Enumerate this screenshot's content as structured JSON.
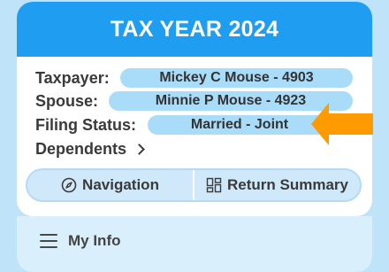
{
  "header": {
    "title": "TAX YEAR 2024"
  },
  "info": {
    "taxpayer_label": "Taxpayer:",
    "taxpayer_value": "Mickey C Mouse - 4903",
    "spouse_label": "Spouse:",
    "spouse_value": "Minnie P Mouse - 4923",
    "filing_status_label": "Filing Status:",
    "filing_status_value": "Married - Joint",
    "dependents_label": "Dependents"
  },
  "buttons": {
    "navigation_label": "Navigation",
    "return_summary_label": "Return Summary"
  },
  "menu": {
    "my_info_label": "My Info"
  },
  "colors": {
    "header": "#1f9df0",
    "pill": "#a9dcf9",
    "arrow": "#ff9a00",
    "background": "#bfe3f8"
  },
  "icons": {
    "navigation": "compass-icon",
    "return_summary": "summary-grid-icon",
    "dependents": "chevron-right-icon",
    "my_info": "hamburger-icon",
    "pointer": "arrow-left-icon"
  }
}
